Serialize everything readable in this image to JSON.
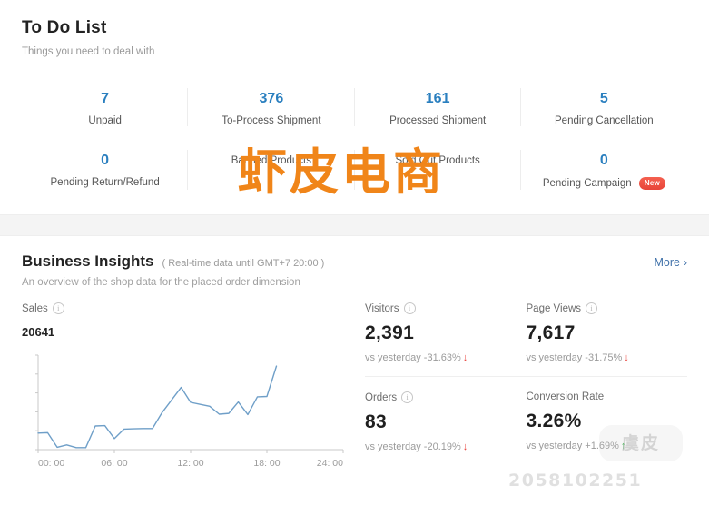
{
  "todo": {
    "title": "To Do List",
    "subtitle": "Things you need to deal with",
    "items": [
      {
        "count": "7",
        "label": "Unpaid",
        "badge": ""
      },
      {
        "count": "376",
        "label": "To-Process Shipment",
        "badge": ""
      },
      {
        "count": "161",
        "label": "Processed Shipment",
        "badge": ""
      },
      {
        "count": "5",
        "label": "Pending Cancellation",
        "badge": ""
      },
      {
        "count": "0",
        "label": "Pending Return/Refund",
        "badge": ""
      },
      {
        "count": "",
        "label": "Banned Products",
        "badge": ""
      },
      {
        "count": "",
        "label": "Sold Out Products",
        "badge": ""
      },
      {
        "count": "0",
        "label": "Pending Campaign",
        "badge": "New"
      }
    ]
  },
  "insights": {
    "title": "Business Insights",
    "realtime": "( Real-time data until GMT+7 20:00 )",
    "subtitle": "An overview of the shop data for the placed order dimension",
    "more_label": "More",
    "more_chevron": "›",
    "sales_label": "Sales",
    "sales_value": "20641",
    "info_glyph": "i",
    "metrics": [
      {
        "label": "Visitors",
        "value": "2,391",
        "delta": "vs yesterday -31.63%",
        "direction": "down",
        "arrow": "↓"
      },
      {
        "label": "Page Views",
        "value": "7,617",
        "delta": "vs yesterday -31.75%",
        "direction": "down",
        "arrow": "↓"
      },
      {
        "label": "Orders",
        "value": "83",
        "delta": "vs yesterday -20.19%",
        "direction": "down",
        "arrow": "↓"
      },
      {
        "label": "Conversion Rate",
        "value": "3.26%",
        "delta": "vs yesterday +1.69%",
        "direction": "up",
        "arrow": "↑"
      }
    ]
  },
  "chart_data": {
    "type": "line",
    "title": "Sales",
    "xlabel": "",
    "ylabel": "",
    "series_color": "#6f9fc8",
    "grid": false,
    "legend": "none",
    "tick_labels": [
      "00: 00",
      "06: 00",
      "12: 00",
      "18: 00",
      "24: 00"
    ],
    "x": [
      0,
      0.75,
      1.5,
      2.25,
      3,
      3.75,
      4.5,
      5.25,
      6,
      6.75,
      7.5,
      8.25,
      9,
      9.75,
      10.5,
      11.25,
      12,
      12.75,
      13.5,
      14.25,
      15,
      15.75,
      16.5,
      17.25,
      18,
      18.75
    ],
    "x_hours": [
      "00:00",
      "00:45",
      "01:30",
      "02:15",
      "03:00",
      "03:45",
      "04:30",
      "05:15",
      "06:00",
      "06:45",
      "07:30",
      "08:15",
      "09:00",
      "09:45",
      "10:30",
      "11:15",
      "12:00",
      "12:45",
      "13:30",
      "14:15",
      "15:00",
      "15:45",
      "16:30",
      "17:15",
      "18:00",
      "18:45"
    ],
    "values": [
      2100,
      2150,
      300,
      600,
      250,
      250,
      3000,
      3050,
      1400,
      2600,
      2650,
      2670,
      2680,
      4700,
      6300,
      7900,
      6000,
      5750,
      5500,
      4500,
      4600,
      6050,
      4450,
      6700,
      6750,
      10600
    ],
    "xlim": [
      0,
      24
    ],
    "ylim": [
      0,
      12000
    ],
    "total": "20641"
  },
  "watermarks": {
    "main": "虾皮电商",
    "logo": "虞皮",
    "bottom": "2058102251"
  }
}
